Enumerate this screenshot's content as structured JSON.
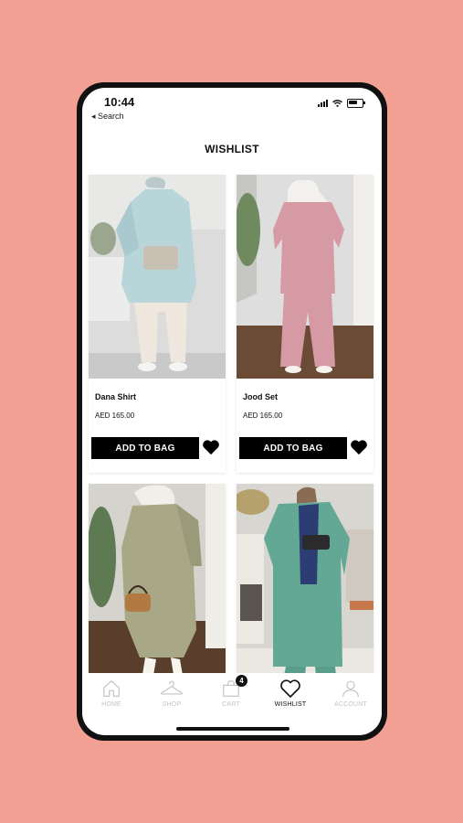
{
  "status_bar": {
    "time": "10:44",
    "back_label": "◂ Search"
  },
  "page": {
    "title": "WISHLIST"
  },
  "products": [
    {
      "name": "Dana Shirt",
      "price": "AED 165.00",
      "button": "ADD TO BAG",
      "top_color": "#b8d6da",
      "bottom_color": "#efe6dd",
      "background": "#dcdcdc"
    },
    {
      "name": "Jood Set",
      "price": "AED 165.00",
      "button": "ADD TO BAG",
      "top_color": "#d69aa4",
      "bottom_color": "#d69aa4",
      "background": "#dedede"
    },
    {
      "top_color": "#a9a886",
      "background": "#d5d3cd"
    },
    {
      "top_color": "#62a895",
      "background": "#d8d6d0"
    }
  ],
  "tabbar": {
    "tabs": [
      {
        "label": "HOME",
        "icon": "home-icon",
        "active": false
      },
      {
        "label": "SHOP",
        "icon": "hanger-icon",
        "active": false
      },
      {
        "label": "CART",
        "icon": "bag-icon",
        "active": false,
        "badge": "4"
      },
      {
        "label": "WISHLIST",
        "icon": "heart-icon",
        "active": true
      },
      {
        "label": "ACCOUNT",
        "icon": "user-icon",
        "active": false
      }
    ]
  },
  "colors": {
    "background": "#f2a093",
    "button": "#000000",
    "inactive_tab": "#c4c4c4"
  }
}
